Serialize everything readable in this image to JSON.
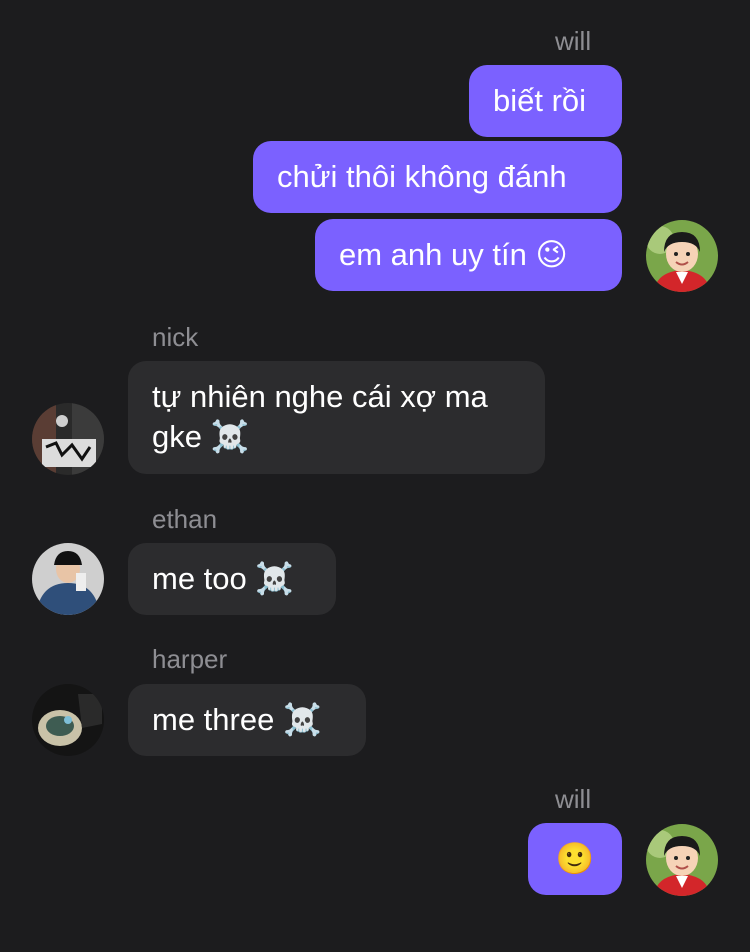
{
  "messages": {
    "will_1": {
      "sender": "will",
      "lines": [
        "biết rồi",
        "chửi thôi không đánh",
        "em anh uy tín"
      ],
      "emoji": "😉"
    },
    "nick": {
      "sender": "nick",
      "text": "tự nhiên nghe cái xợ ma gke",
      "emoji": "☠️"
    },
    "ethan": {
      "sender": "ethan",
      "text": "me too",
      "emoji": "☠️"
    },
    "harper": {
      "sender": "harper",
      "text": "me three",
      "emoji": "☠️"
    },
    "will_2": {
      "sender": "will",
      "emoji": "🙂"
    }
  },
  "colors": {
    "background": "#1c1c1e",
    "outgoing_bubble": "#7b61ff",
    "incoming_bubble": "#2c2c2e",
    "sender_name": "#8e8e93"
  },
  "icons": {
    "will_avatar": "child-photo-avatar",
    "nick_avatar": "graffiti-photo-avatar",
    "ethan_avatar": "person-photo-avatar",
    "harper_avatar": "object-photo-avatar"
  }
}
